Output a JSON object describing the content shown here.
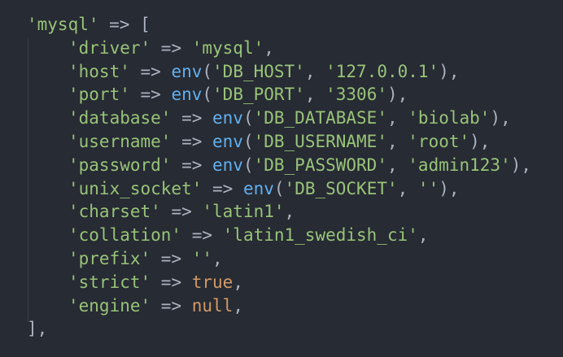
{
  "colors": {
    "background": "#272b33",
    "string": "#98c379",
    "function": "#61afef",
    "constant": "#d19a66",
    "plain": "#abb2bf"
  },
  "code": {
    "open_key": "'mysql'",
    "open_arrow": " => ",
    "open_bracket": "[",
    "entries": [
      {
        "key": "'driver'",
        "value": "'mysql'"
      },
      {
        "key": "'host'",
        "env": "DB_HOST",
        "default": "'127.0.0.1'"
      },
      {
        "key": "'port'",
        "env": "DB_PORT",
        "default": "'3306'"
      },
      {
        "key": "'database'",
        "env": "DB_DATABASE",
        "default": "'biolab'"
      },
      {
        "key": "'username'",
        "env": "DB_USERNAME",
        "default": "'root'"
      },
      {
        "key": "'password'",
        "env": "DB_PASSWORD",
        "default": "'admin123'"
      },
      {
        "key": "'unix_socket'",
        "env": "DB_SOCKET",
        "default": "''"
      },
      {
        "key": "'charset'",
        "value": "'latin1'"
      },
      {
        "key": "'collation'",
        "value": "'latin1_swedish_ci'"
      },
      {
        "key": "'prefix'",
        "value": "''"
      },
      {
        "key": "'strict'",
        "literal": "true"
      },
      {
        "key": "'engine'",
        "literal": "null"
      }
    ],
    "env_fn": "env",
    "env_keys": {
      "host": "'DB_HOST'",
      "port": "'DB_PORT'",
      "database": "'DB_DATABASE'",
      "username": "'DB_USERNAME'",
      "password": "'DB_PASSWORD'",
      "socket": "'DB_SOCKET'"
    },
    "close": "],"
  }
}
